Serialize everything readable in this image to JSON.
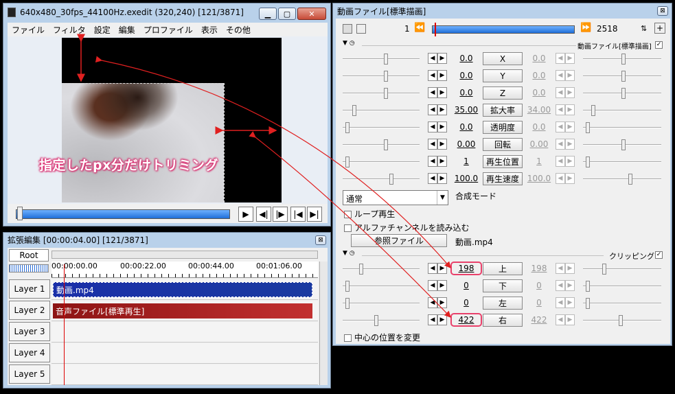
{
  "main": {
    "title": "640x480_30fps_44100Hz.exedit (320,240)  [121/3871]",
    "menu": [
      "ファイル",
      "フィルタ",
      "設定",
      "編集",
      "プロファイル",
      "表示",
      "その他"
    ],
    "annotation": "指定したpx分だけトリミング",
    "playback": [
      "play-icon",
      "prev-frame-icon",
      "next-frame-icon",
      "jump-start-icon",
      "jump-end-icon"
    ]
  },
  "timeline": {
    "title": "拡張編集 [00:00:04.00] [121/3871]",
    "root": "Root",
    "ticks": [
      "00:00:00.00",
      "00:00:22.00",
      "00:00:44.00",
      "00:01:06.00"
    ],
    "layers": [
      "Layer 1",
      "Layer 2",
      "Layer 3",
      "Layer 4",
      "Layer 5"
    ],
    "objects": {
      "video": "動画.mp4",
      "audio": "音声ファイル[標準再生]"
    }
  },
  "props": {
    "title": "動画ファイル[標準描画]",
    "frame_start": "1",
    "frame_end": "2518",
    "section1": "動画ファイル[標準描画]",
    "params": [
      {
        "label": "X",
        "value": "0.0",
        "end": "0.0"
      },
      {
        "label": "Y",
        "value": "0.0",
        "end": "0.0"
      },
      {
        "label": "Z",
        "value": "0.0",
        "end": "0.0"
      },
      {
        "label": "拡大率",
        "value": "35.00",
        "end": "34.00"
      },
      {
        "label": "透明度",
        "value": "0.0",
        "end": "0.0"
      },
      {
        "label": "回転",
        "value": "0.00",
        "end": "0.00"
      },
      {
        "label": "再生位置",
        "value": "1",
        "end": "1"
      },
      {
        "label": "再生速度",
        "value": "100.0",
        "end": "100.0"
      }
    ],
    "blend_value": "通常",
    "blend_label": "合成モード",
    "loop": "ループ再生",
    "alpha": "アルファチャンネルを読み込む",
    "ref_button": "参照ファイル",
    "ref_file": "動画.mp4",
    "section2": "クリッピング",
    "clip_params": [
      {
        "label": "上",
        "value": "198",
        "end": "198"
      },
      {
        "label": "下",
        "value": "0",
        "end": "0"
      },
      {
        "label": "左",
        "value": "0",
        "end": "0"
      },
      {
        "label": "右",
        "value": "422",
        "end": "422"
      }
    ],
    "center": "中心の位置を変更"
  },
  "colors": {
    "accent": "#e8406a",
    "arrow": "#e02020",
    "video_obj": "#1a2fa8",
    "audio_obj": "#b02020"
  }
}
